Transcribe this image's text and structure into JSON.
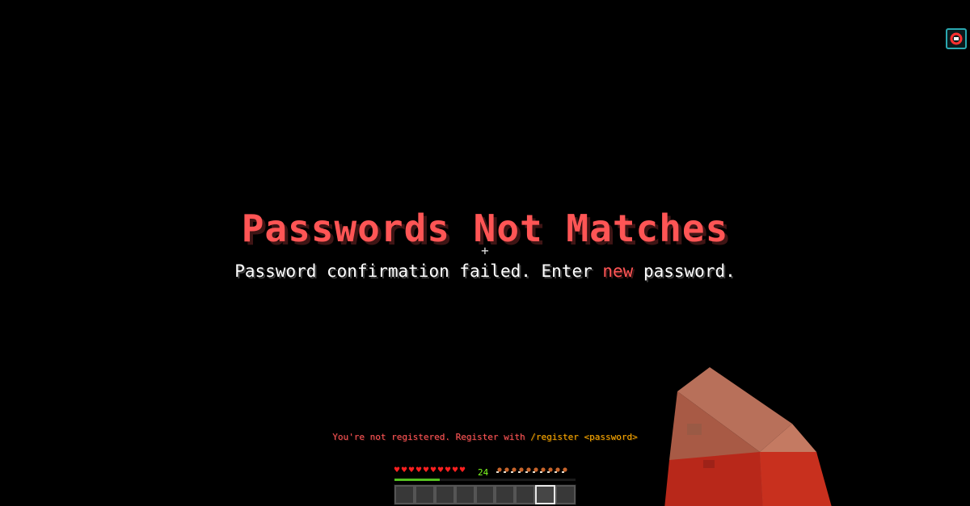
{
  "title": {
    "text": "Passwords Not Matches"
  },
  "crosshair": "+",
  "subtitle": {
    "before": "Password confirmation failed. Enter ",
    "highlight": "new",
    "after": " password."
  },
  "chat": {
    "red_part": "You're not registered. Register with ",
    "gold_part": "/register <password>"
  },
  "hud": {
    "hearts_count": 10,
    "food_count": 10,
    "level": "24",
    "xp_progress": 0.25,
    "hotbar_slots": 9,
    "selected_slot": 8
  },
  "colors": {
    "title_red": "#ff5555",
    "hotbar_selected": "#e8e8e8",
    "xp_green": "#55c020",
    "arm_skin": "#c0735a"
  },
  "icons": {
    "top_right": "screen-recorder-icon",
    "heart": "heart-icon",
    "food": "drumstick-icon"
  }
}
